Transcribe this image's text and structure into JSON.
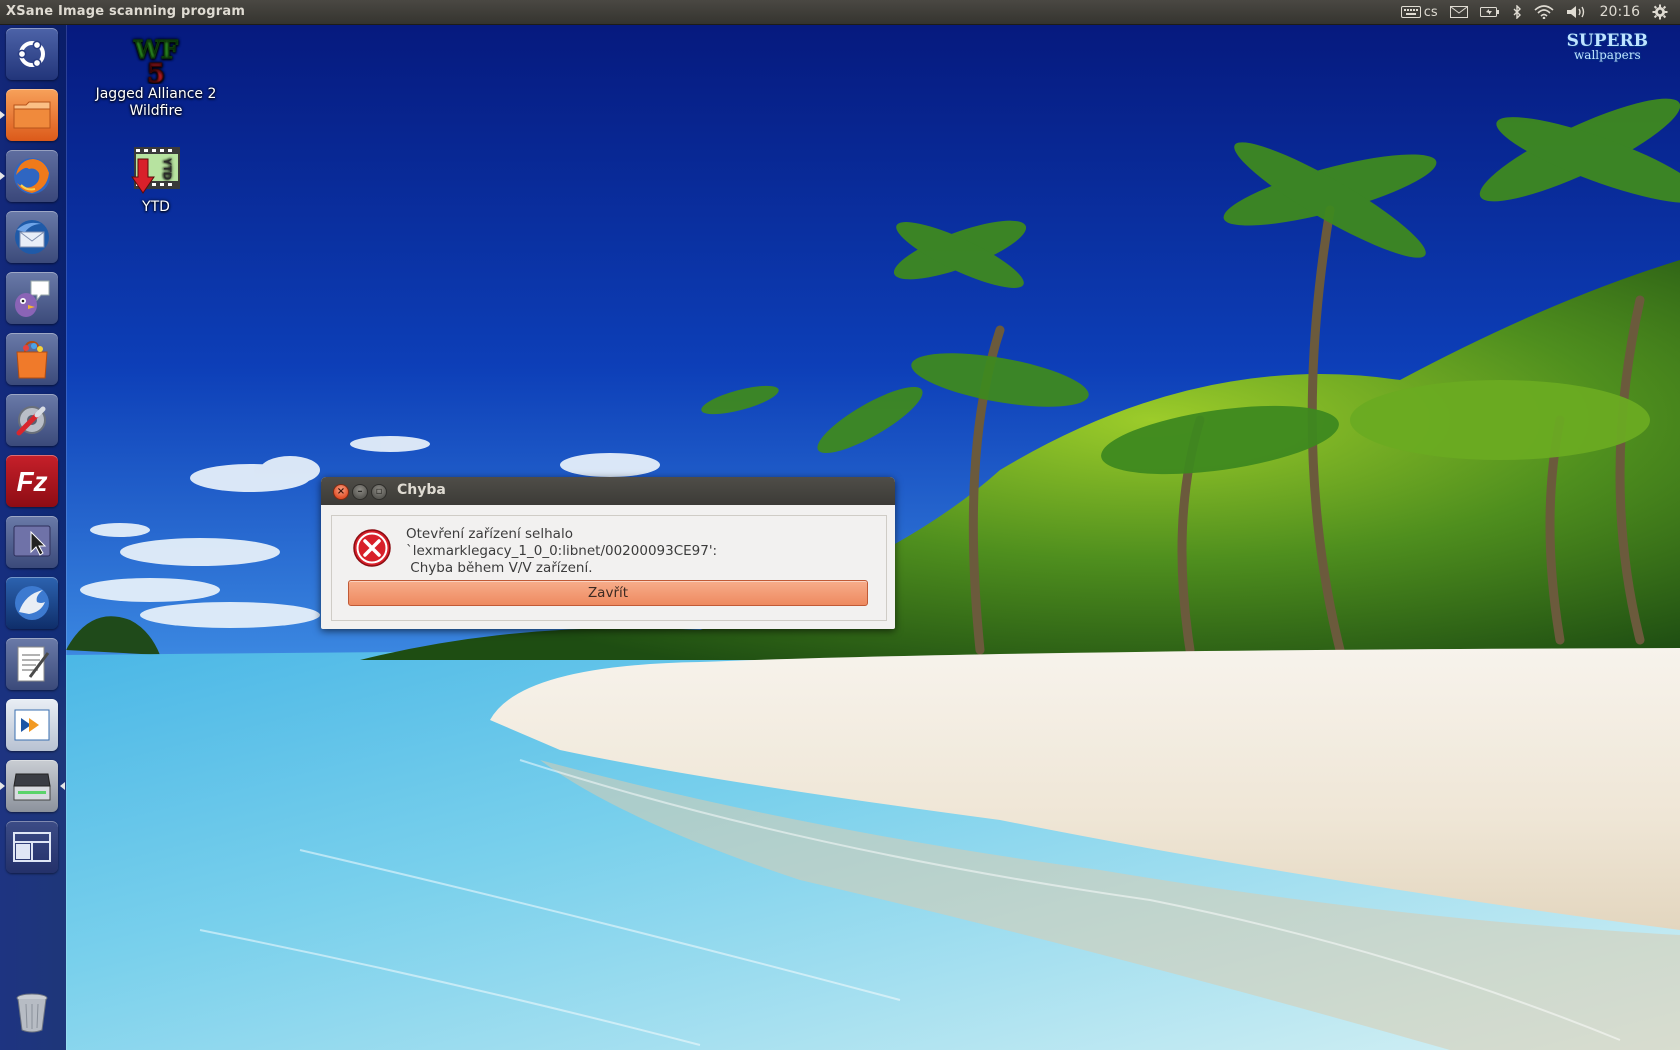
{
  "top_panel": {
    "app_title": "XSane Image scanning program",
    "keyboard_layout": "cs",
    "clock": "20:16",
    "indicators": [
      "keyboard-icon",
      "mail-icon",
      "battery-icon",
      "bluetooth-icon",
      "wifi-icon",
      "volume-icon",
      "gear-icon"
    ]
  },
  "launcher": {
    "items": [
      "dash-home",
      "files",
      "firefox",
      "thunderbird",
      "pidgin",
      "software-center",
      "system-settings",
      "filezilla",
      "screen-presenter",
      "sane-wolf",
      "text-editor",
      "remote-desktop",
      "xsane-scanner",
      "workspace-switcher",
      "trash"
    ]
  },
  "desktop": {
    "icons": [
      {
        "label_line1": "Jagged Alliance 2",
        "label_line2": "Wildfire",
        "icon": "wf5-game-icon"
      },
      {
        "label_line1": "YTD",
        "label_line2": "",
        "icon": "ytd-download-icon"
      }
    ],
    "watermark_line1": "SUPERB",
    "watermark_line2": "wallpapers"
  },
  "dialog": {
    "title": "Chyba",
    "message_line1": "Otevření zařízení selhalo `lexmarklegacy_1_0_0:libnet/00200093CE97':",
    "message_line2": " Chyba během V/V zařízení.",
    "button_label": "Zavřít"
  },
  "colors": {
    "panel_bg": "#3c3b37",
    "accent_button": "#f08c62",
    "close_button": "#e2522a",
    "error_red": "#d8202a",
    "sky": "#0b2a8a"
  }
}
